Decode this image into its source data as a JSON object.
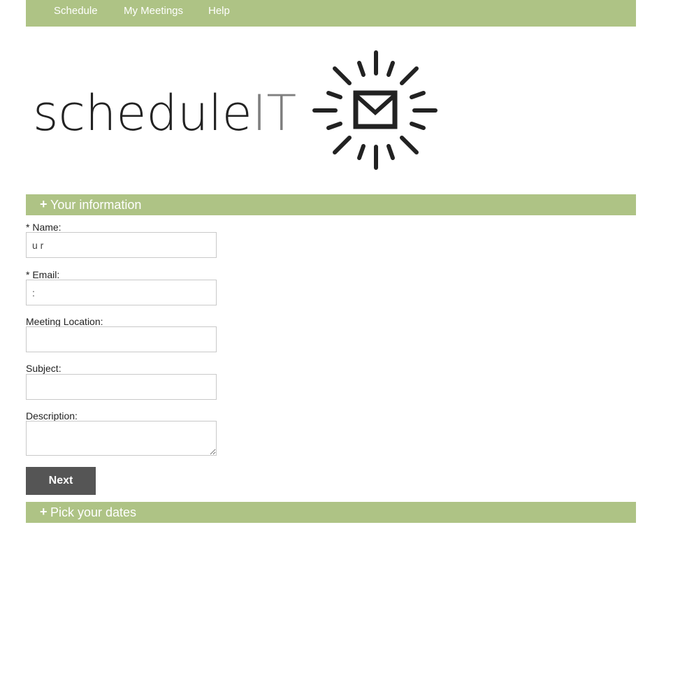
{
  "nav": {
    "items": [
      "Schedule",
      "My Meetings",
      "Help"
    ]
  },
  "logo": {
    "text_main": "schedule",
    "text_accent": "IT",
    "colors": {
      "main": "#222222",
      "accent": "#7f7f7f"
    },
    "icon": "envelope-sunburst-icon"
  },
  "sections": {
    "info": {
      "plus": "+",
      "title": "Your information"
    },
    "dates": {
      "plus": "+",
      "title": "Pick your dates"
    }
  },
  "form": {
    "name": {
      "label": "* Name:",
      "value": "u r"
    },
    "email": {
      "label": "* Email:",
      "value": ":"
    },
    "location": {
      "label": "Meeting Location:",
      "value": ""
    },
    "subject": {
      "label": "Subject:",
      "value": ""
    },
    "description": {
      "label": "Description:",
      "value": ""
    }
  },
  "buttons": {
    "next": "Next"
  },
  "colors": {
    "accent_green": "#aec385",
    "button_gray": "#555555"
  }
}
